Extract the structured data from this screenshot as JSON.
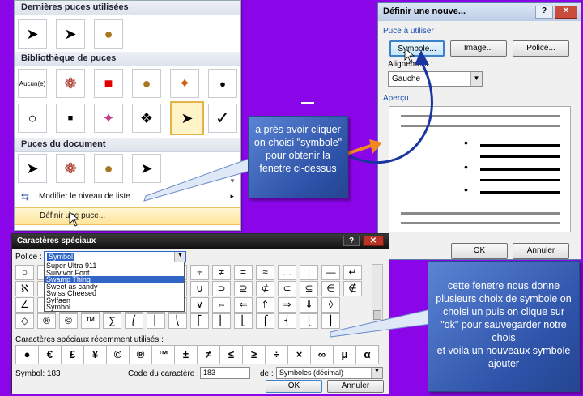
{
  "gallery": {
    "recent_title": "Dernières puces utilisées",
    "library_title": "Bibliothèque de puces",
    "document_title": "Puces du document",
    "none_label": "Aucun(e)",
    "recent_bullets": [
      "➤",
      "➤",
      "●"
    ],
    "library_row1": [
      "Aucun(e)",
      "❁",
      "■",
      "●",
      "✦",
      "●"
    ],
    "library_row2": [
      "○",
      "■",
      "✦",
      "❖",
      "➤",
      "✓"
    ],
    "document_bullets": [
      "➤",
      "❁",
      "●",
      "➤"
    ],
    "menu_change_level": "Modifier le niveau de liste",
    "menu_define": "Définir une puce..."
  },
  "dialog1": {
    "title": "Définir une nouve...",
    "group_bullet": "Puce à utiliser",
    "btn_symbol": "Symbole...",
    "btn_image": "Image...",
    "btn_font": "Police...",
    "align_label": "Alignement :",
    "align_value": "Gauche",
    "preview_label": "Aperçu",
    "preview_bullet": "•",
    "ok": "OK",
    "cancel": "Annuler",
    "help_icon": "?",
    "close_icon": "✕"
  },
  "dialog2": {
    "title": "Caractères spéciaux",
    "font_label": "Police :",
    "font_value": "Symbol",
    "font_options": [
      "Super Ultra 911",
      "Survivor Font",
      "Swamp Thing",
      "Sweet as candy",
      "Swiss Cheesed",
      "Sylfaen",
      "Symbol"
    ],
    "font_selected_index": 2,
    "grid_rows": [
      [
        "○",
        "",
        "",
        "",
        "",
        "",
        "",
        "",
        "÷",
        "≠",
        "=",
        "≈",
        "…",
        "|",
        "—",
        "↵"
      ],
      [
        "ℵ",
        "",
        "",
        "",
        "",
        "",
        "",
        "",
        "∪",
        "⊃",
        "⊇",
        "⊄",
        "⊂",
        "⊆",
        "∈",
        "∉"
      ],
      [
        "∠",
        "",
        "",
        "",
        "",
        "",
        "",
        "",
        "∨",
        "⇔",
        "⇐",
        "⇑",
        "⇒",
        "⇓",
        "◊"
      ],
      [
        "◇",
        "®",
        "©",
        "™",
        "∑",
        "⎛",
        "⎜",
        "⎝",
        "⎡",
        "⎢",
        "⎣",
        "⎧",
        "⎨",
        "⎩",
        "⎪"
      ]
    ],
    "recent_label": "Caractères spéciaux récemment utilisés :",
    "recent_chars": [
      "●",
      "€",
      "£",
      "¥",
      "©",
      "®",
      "™",
      "±",
      "≠",
      "≤",
      "≥",
      "÷",
      "×",
      "∞",
      "μ",
      "α"
    ],
    "symbol_info": "Symbol: 183",
    "code_label": "Code du caractère :",
    "code_value": "183",
    "from_label": "de :",
    "from_value": "Symboles (décimal)",
    "ok": "OK",
    "cancel": "Annuler",
    "help_icon": "?",
    "close_icon": "✕"
  },
  "callout1": "a près avoir cliquer on choisi \"symbole\" pour obtenir la fenetre ci-dessus",
  "callout2": "cette fenetre nous donne plusieurs choix de symbole on choisi un puis on clique sur \"ok\" pour sauvegarder notre chois\net voila un nouveaux symbole ajouter",
  "colors": {
    "background": "#8a06e8",
    "callout": "#3a62b8",
    "arrow": "#f08a20"
  }
}
